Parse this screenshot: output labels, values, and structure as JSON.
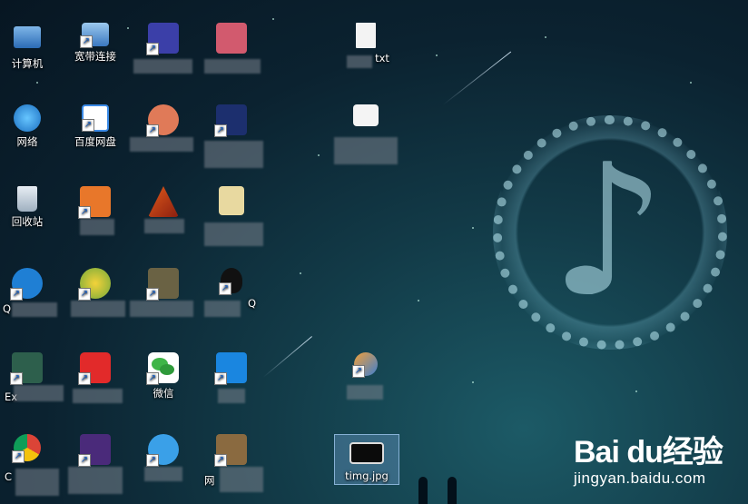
{
  "desktop": {
    "icons": [
      {
        "id": "computer",
        "label": "计算机",
        "icon": "computer-icon",
        "shortcut": false
      },
      {
        "id": "broadband",
        "label": "宽带连接",
        "icon": "network-connection-icon",
        "shortcut": true
      },
      {
        "id": "blur1",
        "label": "",
        "icon": "app-icon",
        "shortcut": true
      },
      {
        "id": "blur2",
        "label": "",
        "icon": "app-icon",
        "shortcut": true
      },
      {
        "id": "txt",
        "label": "txt",
        "icon": "text-file-icon",
        "shortcut": false
      },
      {
        "id": "network",
        "label": "网络",
        "icon": "network-globe-icon",
        "shortcut": false
      },
      {
        "id": "baidu-pan",
        "label": "百度网盘",
        "icon": "baidu-netdisk-icon",
        "shortcut": true
      },
      {
        "id": "blur3",
        "label": "",
        "icon": "app-icon",
        "shortcut": true
      },
      {
        "id": "blur4",
        "label": "",
        "icon": "app-icon",
        "shortcut": true
      },
      {
        "id": "blur5",
        "label": "",
        "icon": "app-icon",
        "shortcut": false
      },
      {
        "id": "recycle",
        "label": "回收站",
        "icon": "recycle-bin-icon",
        "shortcut": false
      },
      {
        "id": "blur6",
        "label": "",
        "icon": "app-icon",
        "shortcut": true
      },
      {
        "id": "blur7",
        "label": "",
        "icon": "matlab-icon",
        "shortcut": true
      },
      {
        "id": "blur8",
        "label": "",
        "icon": "file-icon",
        "shortcut": false
      },
      {
        "id": "blur9",
        "label": "Q",
        "icon": "app-icon",
        "shortcut": true
      },
      {
        "id": "blur10",
        "label": "",
        "icon": "app-icon",
        "shortcut": true
      },
      {
        "id": "blur11",
        "label": "",
        "icon": "app-icon",
        "shortcut": true
      },
      {
        "id": "qq",
        "label": "Q",
        "icon": "qq-penguin-icon",
        "shortcut": true
      },
      {
        "id": "blur12",
        "label": "Ex",
        "icon": "app-icon",
        "shortcut": true
      },
      {
        "id": "netease",
        "label": "",
        "icon": "netease-music-icon",
        "shortcut": true
      },
      {
        "id": "wechat",
        "label": "微信",
        "icon": "wechat-icon",
        "shortcut": true
      },
      {
        "id": "blur13",
        "label": "",
        "icon": "app-icon",
        "shortcut": true
      },
      {
        "id": "paint",
        "label": "",
        "icon": "paint-icon",
        "shortcut": true
      },
      {
        "id": "chrome",
        "label": "C",
        "icon": "chrome-icon",
        "shortcut": true
      },
      {
        "id": "blur14",
        "label": "",
        "icon": "app-icon",
        "shortcut": true
      },
      {
        "id": "blur15",
        "label": "",
        "icon": "app-icon",
        "shortcut": true
      },
      {
        "id": "blur16",
        "label": "网",
        "icon": "app-icon",
        "shortcut": true
      },
      {
        "id": "timg",
        "label": "timg.jpg",
        "icon": "image-file-icon",
        "shortcut": false
      }
    ]
  },
  "watermark": {
    "brand": "Bai  du经验",
    "url": "jingyan.baidu.com"
  }
}
